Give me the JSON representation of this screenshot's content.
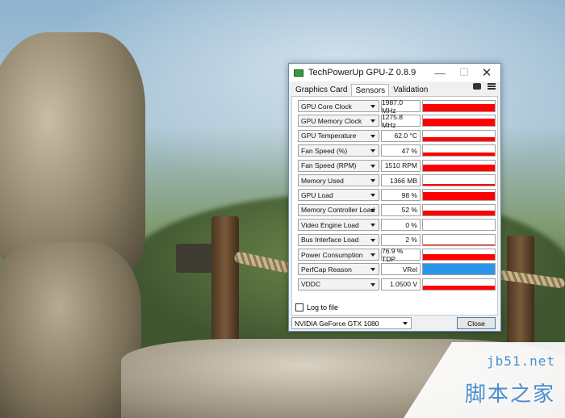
{
  "window": {
    "title": "TechPowerUp GPU-Z 0.8.9",
    "controls": {
      "minimize": "—",
      "maximize": "☐",
      "close": "✕"
    }
  },
  "tabs": [
    {
      "label": "Graphics Card",
      "active": false
    },
    {
      "label": "Sensors",
      "active": true
    },
    {
      "label": "Validation",
      "active": false
    }
  ],
  "sensors": [
    {
      "label": "GPU Core Clock",
      "value": "1987.0 MHz",
      "fill": 0.7,
      "color": "#ff0000"
    },
    {
      "label": "GPU Memory Clock",
      "value": "1275.8 MHz",
      "fill": 0.7,
      "color": "#ff0000"
    },
    {
      "label": "GPU Temperature",
      "value": "62.0 °C",
      "fill": 0.35,
      "color": "#ff0000"
    },
    {
      "label": "Fan Speed (%)",
      "value": "47 %",
      "fill": 0.35,
      "color": "#ff0000"
    },
    {
      "label": "Fan Speed (RPM)",
      "value": "1510 RPM",
      "fill": 0.55,
      "color": "#ff0000"
    },
    {
      "label": "Memory Used",
      "value": "1366 MB",
      "fill": 0.12,
      "color": "#ff0000"
    },
    {
      "label": "GPU Load",
      "value": "98 %",
      "fill": 0.8,
      "color": "#ff0000"
    },
    {
      "label": "Memory Controller Load",
      "value": "52 %",
      "fill": 0.45,
      "color": "#ff0000"
    },
    {
      "label": "Video Engine Load",
      "value": "0 %",
      "fill": 0.0,
      "color": "#ff0000"
    },
    {
      "label": "Bus Interface Load",
      "value": "2 %",
      "fill": 0.05,
      "color": "#ff0000"
    },
    {
      "label": "Power Consumption",
      "value": "76.9 % TDP",
      "fill": 0.55,
      "color": "#ff0000"
    },
    {
      "label": "PerfCap Reason",
      "value": "VRel",
      "fill": 1.0,
      "color": "#2b95e8"
    },
    {
      "label": "VDDC",
      "value": "1.0500 V",
      "fill": 0.35,
      "color": "#ff0000"
    }
  ],
  "footer": {
    "log_to_file": "Log to file",
    "gpu_select": "NVIDIA GeForce GTX 1080",
    "close": "Close"
  },
  "watermark": {
    "site": "jb51.net",
    "brand": "脚本之家"
  }
}
